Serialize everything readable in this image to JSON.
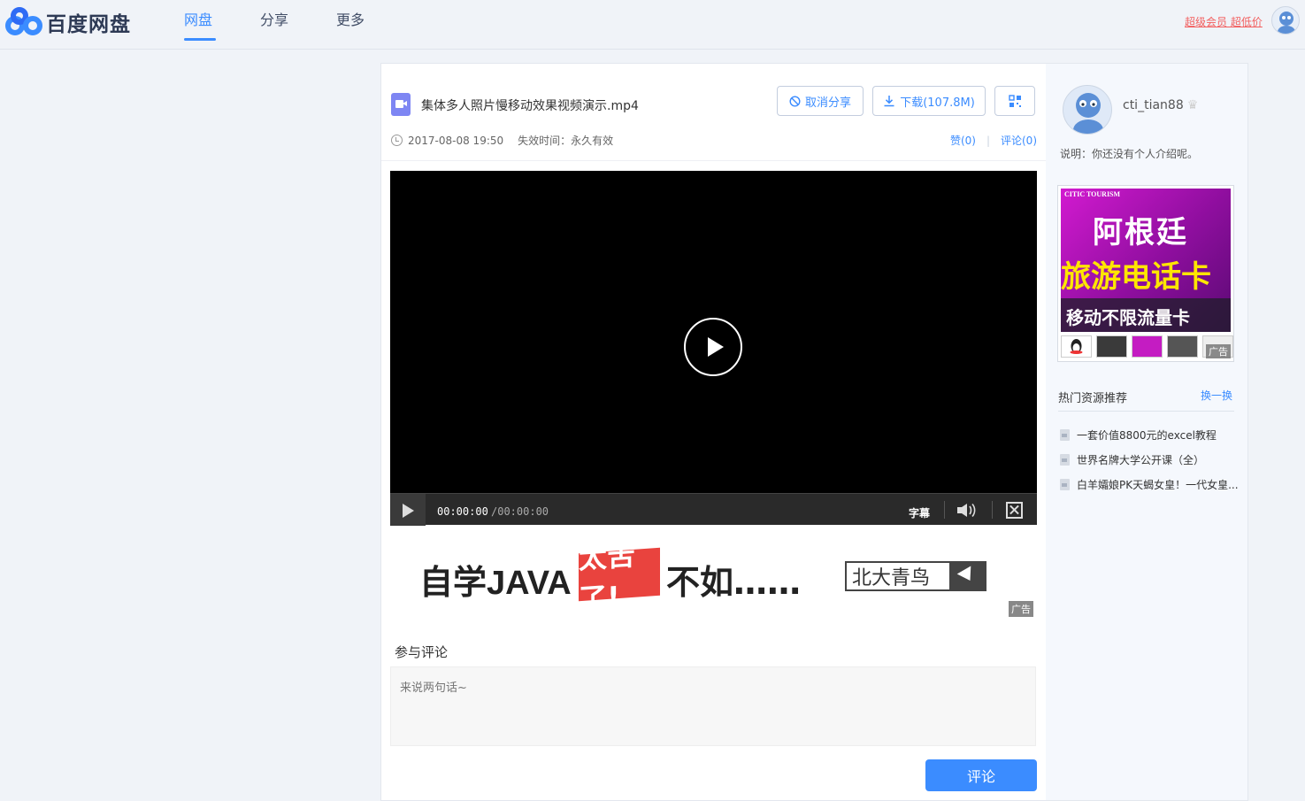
{
  "header": {
    "logo_text": "百度网盘",
    "nav": [
      "网盘",
      "分享",
      "更多"
    ],
    "vip_link": "超级会员 超低价"
  },
  "file": {
    "name": "集体多人照片慢移动效果视频演示.mp4",
    "cancel_share_label": "取消分享",
    "download_label": "下载(107.8M)",
    "date": "2017-08-08 19:50",
    "expire": "失效时间：永久有效",
    "likes_label": "赞(0)",
    "comments_label": "评论(0)"
  },
  "player": {
    "current_time": "00:00:00",
    "total_time": "/00:00:00",
    "subtitle_label": "字幕"
  },
  "banner_ad": {
    "text_a": "自学JAVA",
    "text_b": "太苦了!",
    "text_c": "不如……",
    "text_d": "北大青鸟",
    "tag": "广告"
  },
  "comment": {
    "title": "参与评论",
    "placeholder": "来说两句话~",
    "submit_label": "评论"
  },
  "sidebar": {
    "username": "cti_tian88",
    "description": "说明：你还没有个人介绍呢。",
    "ad": {
      "brand": "CITIC TOURISM",
      "line1": "阿根廷",
      "line2": "旅游电话卡",
      "line3": "移动不限流量卡",
      "tag": "广告"
    },
    "hot_title": "热门资源推荐",
    "hot_change": "换一换",
    "hot_items": [
      "一套价值8800元的excel教程",
      "世界名牌大学公开课（全）",
      "白羊孀娘PK天蝎女皇！一代女皇..."
    ]
  },
  "colors": {
    "accent": "#3b8cff",
    "vip_red": "#f25e5e",
    "page_bg": "#f0f3f8"
  }
}
